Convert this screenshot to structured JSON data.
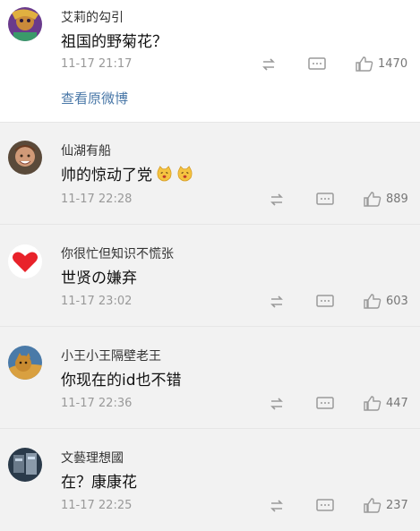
{
  "comments": [
    {
      "username": "艾莉的勾引",
      "text": "祖国的野菊花？",
      "time": "11-17 21:17",
      "likes": "1470",
      "view_original": "查看原微博"
    },
    {
      "username": "仙湖有船",
      "text": "帅的惊动了党",
      "time": "11-17 22:28",
      "likes": "889"
    },
    {
      "username": "你很忙但知识不慌张",
      "text": "世贤の嫌弃",
      "time": "11-17 23:02",
      "likes": "603"
    },
    {
      "username": "小王小王隔壁老王",
      "text": "你现在的id也不错",
      "time": "11-17 22:36",
      "likes": "447"
    },
    {
      "username": "文藝理想國",
      "text": "在？康康花",
      "time": "11-17 22:25",
      "likes": "237"
    }
  ],
  "icons": {
    "repost": "repost-icon",
    "comment": "comment-icon",
    "like": "thumbs-up-icon"
  },
  "colors": {
    "link": "#4a78a8",
    "time": "#999999",
    "background": "#f2f2f2"
  }
}
